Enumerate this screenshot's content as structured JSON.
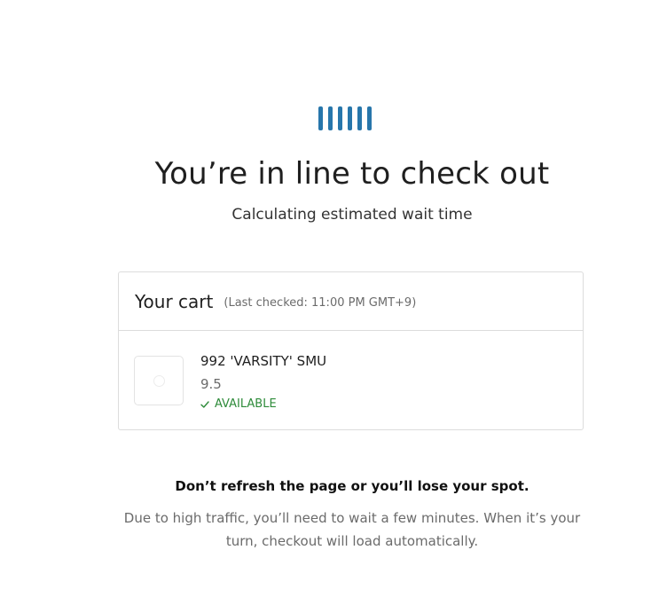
{
  "colors": {
    "spinner": "#2776ab",
    "available": "#2e8b3a",
    "border": "#dcdcdc",
    "muted_text": "#6b6b6b"
  },
  "spinner": {
    "icon": "loading-bars-icon",
    "bar_count": 6
  },
  "queue": {
    "title": "You’re in line to check out",
    "subtitle": "Calculating estimated wait time"
  },
  "cart": {
    "title": "Your cart",
    "last_checked": "(Last checked: 11:00 PM GMT+9)",
    "items": [
      {
        "image_icon": "product-placeholder-icon",
        "name": "992 'VARSITY' SMU",
        "size": "9.5",
        "status_icon": "check-icon",
        "status": "AVAILABLE"
      }
    ]
  },
  "notice": {
    "warning": "Don’t refresh the page or you’ll lose your spot.",
    "body": "Due to high traffic, you’ll need to wait a few minutes. When it’s your turn, checkout will load automatically."
  }
}
